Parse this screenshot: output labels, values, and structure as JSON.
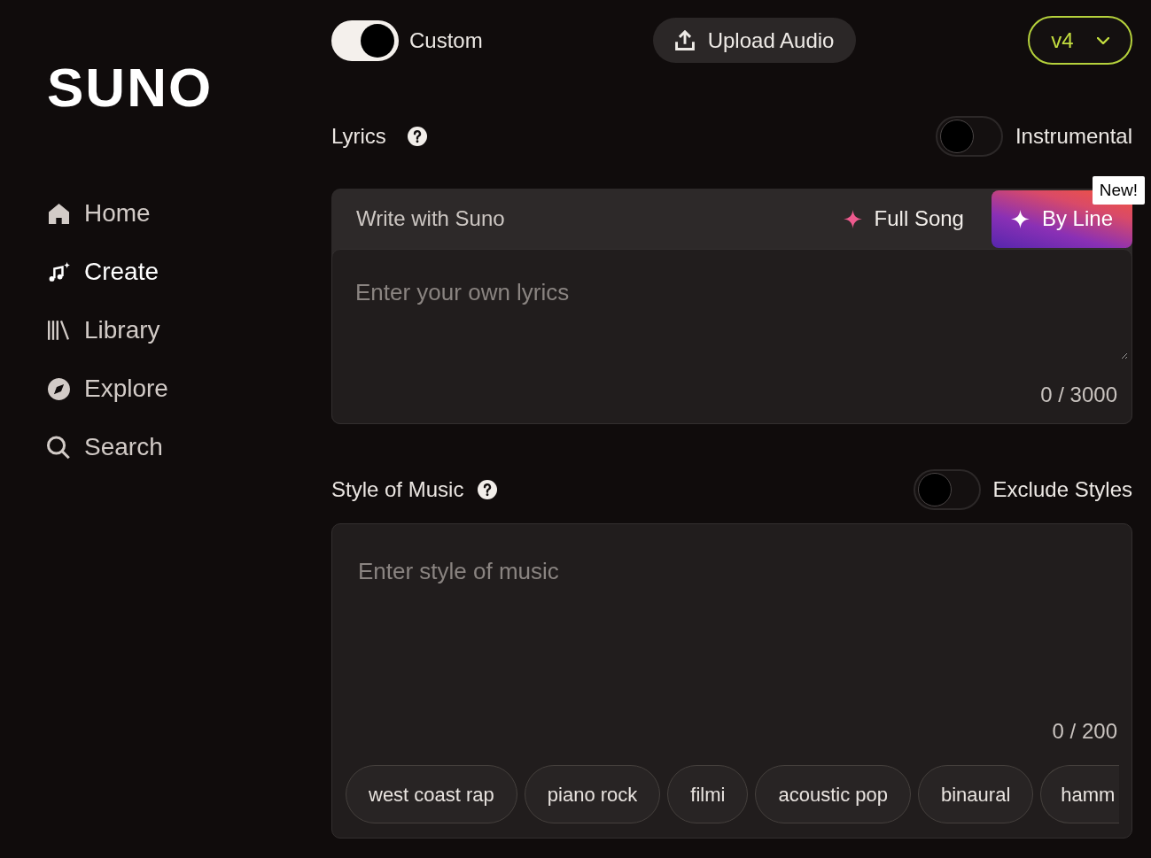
{
  "sidebar": {
    "logo": "SUNO",
    "items": [
      {
        "label": "Home",
        "selected": false
      },
      {
        "label": "Create",
        "selected": true
      },
      {
        "label": "Library",
        "selected": false
      },
      {
        "label": "Explore",
        "selected": false
      },
      {
        "label": "Search",
        "selected": false
      }
    ]
  },
  "top_bar": {
    "custom_toggle": {
      "label": "Custom",
      "on": true
    },
    "upload_button": {
      "label": "Upload Audio"
    },
    "model_select": {
      "value": "v4"
    }
  },
  "lyrics": {
    "title": "Lyrics",
    "instrumental_toggle": {
      "label": "Instrumental",
      "on": false
    },
    "write_with": {
      "label": "Write with Suno",
      "modes": [
        {
          "label": "Full Song",
          "selected": false
        },
        {
          "label": "By Line",
          "selected": true,
          "badge": "New!"
        }
      ]
    },
    "placeholder": "Enter your own lyrics",
    "counter": "0 / 3000"
  },
  "style": {
    "title": "Style of Music",
    "exclude_toggle": {
      "label": "Exclude Styles",
      "on": false
    },
    "placeholder": "Enter style of music",
    "counter": "0 / 200",
    "tags": [
      {
        "label": "west coast rap",
        "cut_off": false
      },
      {
        "label": "piano rock",
        "cut_off": false
      },
      {
        "label": "filmi",
        "cut_off": false
      },
      {
        "label": "acoustic pop",
        "cut_off": false
      },
      {
        "label": "binaural",
        "cut_off": false
      },
      {
        "label": "hamm",
        "cut_off": true
      }
    ]
  }
}
